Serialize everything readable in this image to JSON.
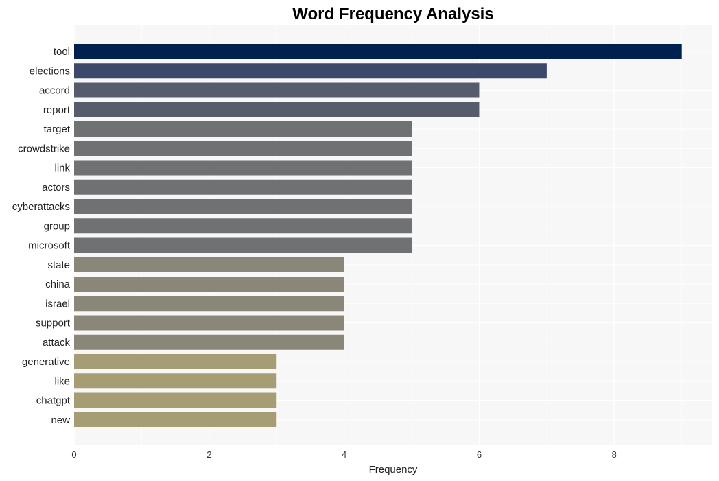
{
  "chart_data": {
    "type": "bar",
    "orientation": "horizontal",
    "title": "Word Frequency Analysis",
    "xlabel": "Frequency",
    "ylabel": "",
    "xlim": [
      0,
      9.45
    ],
    "xticks": [
      0,
      2,
      4,
      6,
      8
    ],
    "grid": true,
    "legend": "none",
    "categories": [
      "tool",
      "elections",
      "accord",
      "report",
      "target",
      "crowdstrike",
      "link",
      "actors",
      "cyberattacks",
      "group",
      "microsoft",
      "state",
      "china",
      "israel",
      "support",
      "attack",
      "generative",
      "like",
      "chatgpt",
      "new"
    ],
    "values": [
      9,
      7,
      6,
      6,
      5,
      5,
      5,
      5,
      5,
      5,
      5,
      4,
      4,
      4,
      4,
      4,
      3,
      3,
      3,
      3
    ],
    "colors_by_value": {
      "9": "#00204e",
      "7": "#3b4a6b",
      "6": "#575c6d",
      "5": "#707173",
      "4": "#8a8779",
      "3": "#a69d75"
    },
    "background": "#f7f7f7"
  }
}
